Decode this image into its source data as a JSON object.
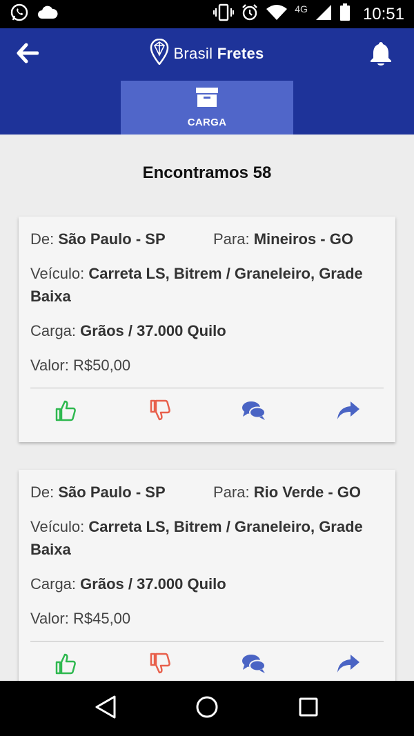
{
  "status_bar": {
    "time": "10:51",
    "network": "4G",
    "icons": [
      "whatsapp-icon",
      "cloud-icon",
      "vibrate-icon",
      "alarm-icon",
      "wifi-icon",
      "signal-icon",
      "battery-icon"
    ]
  },
  "app_bar": {
    "brand_light": "Brasil",
    "brand_bold": "Fretes",
    "icons": [
      "back-arrow-icon",
      "location-pin-icon",
      "bell-icon"
    ]
  },
  "tabs": [
    {
      "label": "CARGA",
      "icon": "archive-box-icon",
      "active": true
    }
  ],
  "results": {
    "title": "Encontramos 58"
  },
  "freights": [
    {
      "from_label": "De:",
      "from": "São Paulo - SP",
      "to_label": "Para:",
      "to": "Mineiros - GO",
      "vehicle_label": "Veículo:",
      "vehicle": "Carreta LS, Bitrem / Graneleiro, Grade Baixa",
      "cargo_label": "Carga:",
      "cargo": "Grãos / 37.000 Quilo",
      "value_label": "Valor:",
      "value": "R$50,00"
    },
    {
      "from_label": "De:",
      "from": "São Paulo - SP",
      "to_label": "Para:",
      "to": "Rio Verde - GO",
      "vehicle_label": "Veículo:",
      "vehicle": "Carreta LS, Bitrem / Graneleiro, Grade Baixa",
      "cargo_label": "Carga:",
      "cargo": "Grãos / 37.000 Quilo",
      "value_label": "Valor:",
      "value": "R$45,00"
    }
  ],
  "colors": {
    "app_bar": "#1e3399",
    "active_tab": "#5066c9",
    "like": "#2eb84f",
    "dislike": "#e8604c",
    "chat": "#4a64c4",
    "share": "#4a64c4"
  }
}
